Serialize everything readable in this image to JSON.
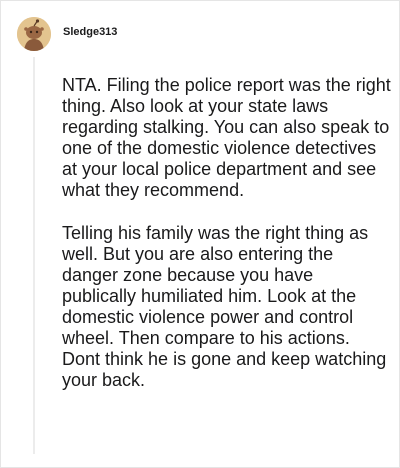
{
  "comment": {
    "username": "Sledge313",
    "avatar_icon": "snoo-avatar-icon",
    "paragraphs": [
      "NTA. Filing the police report was the right thing. Also look at your state laws regarding stalking. You can also speak to one of the domestic violence detectives at your local police department and see what they recommend.",
      "Telling his family was the right thing as well. But you are also entering the danger zone because you have publically humiliated him. Look at the domestic violence power and control wheel. Then compare to his actions. Dont think he is gone and keep watching your back."
    ]
  },
  "colors": {
    "text": "#1a1a1b",
    "thread_line": "#ececec",
    "avatar_bg": "#e3c48f",
    "avatar_figure": "#8a5a3b"
  }
}
